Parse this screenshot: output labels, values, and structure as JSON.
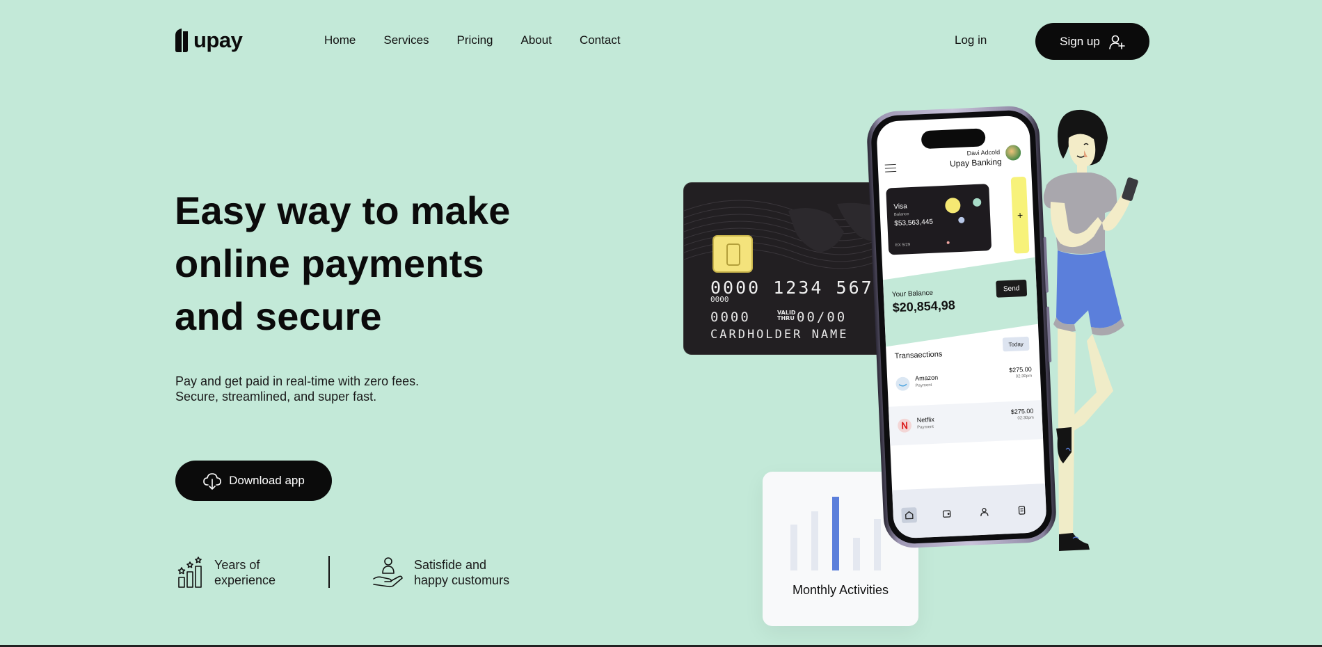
{
  "brand": {
    "name": "upay"
  },
  "nav": {
    "items": [
      "Home",
      "Services",
      "Pricing",
      "About",
      "Contact"
    ],
    "login": "Log in",
    "signup": "Sign up"
  },
  "hero": {
    "title_lines": [
      "Easy way to make",
      "online payments",
      "and secure"
    ],
    "subtitle_lines": [
      "Pay and get paid in real-time with zero fees.",
      "Secure, streamlined, and super fast."
    ],
    "cta": "Download app"
  },
  "stats": [
    {
      "lines": [
        "Years of",
        "experience"
      ],
      "icon": "growth-chart-icon"
    },
    {
      "lines": [
        "Satisfide and",
        "happy customurs"
      ],
      "icon": "hand-user-icon"
    }
  ],
  "credit_card": {
    "number": "0000 1234 5678",
    "small_number": "0000",
    "exp_left": "0000",
    "valid_label_1": "VALID",
    "valid_label_2": "THRU",
    "expiry": "00/00",
    "holder": "CARDHOLDER NAME"
  },
  "activity": {
    "label": "Monthly Activities",
    "bars": [
      0.62,
      0.8,
      1.0,
      0.44,
      0.7
    ],
    "highlight_index": 2,
    "bar_color": "#e4e8f0",
    "highlight_color": "#5b7fdb"
  },
  "phone": {
    "user": "Davi Adcold",
    "bank": "Upay Banking",
    "visa": {
      "title": "Visa",
      "balance_label": "Balance",
      "balance": "$53,563,445",
      "exp": "EX 5/29"
    },
    "add": "+",
    "balance_label": "Your Balance",
    "balance_value": "$20,854,98",
    "send": "Send",
    "transactions_label": "Transaections",
    "filter": "Today",
    "transactions": [
      {
        "name": "Amazon",
        "type": "Payment",
        "amount": "$275.00",
        "time": "02:30pm"
      },
      {
        "name": "Netflix",
        "type": "Payment",
        "amount": "$275.00",
        "time": "02:30pm"
      }
    ],
    "tabs": [
      "home-icon",
      "wallet-icon",
      "profile-icon",
      "card-icon"
    ]
  },
  "colors": {
    "background": "#c3e9d8",
    "primary": "#0b0b0b",
    "accent_yellow": "#f7f27a",
    "accent_blue": "#5b7fdb"
  }
}
